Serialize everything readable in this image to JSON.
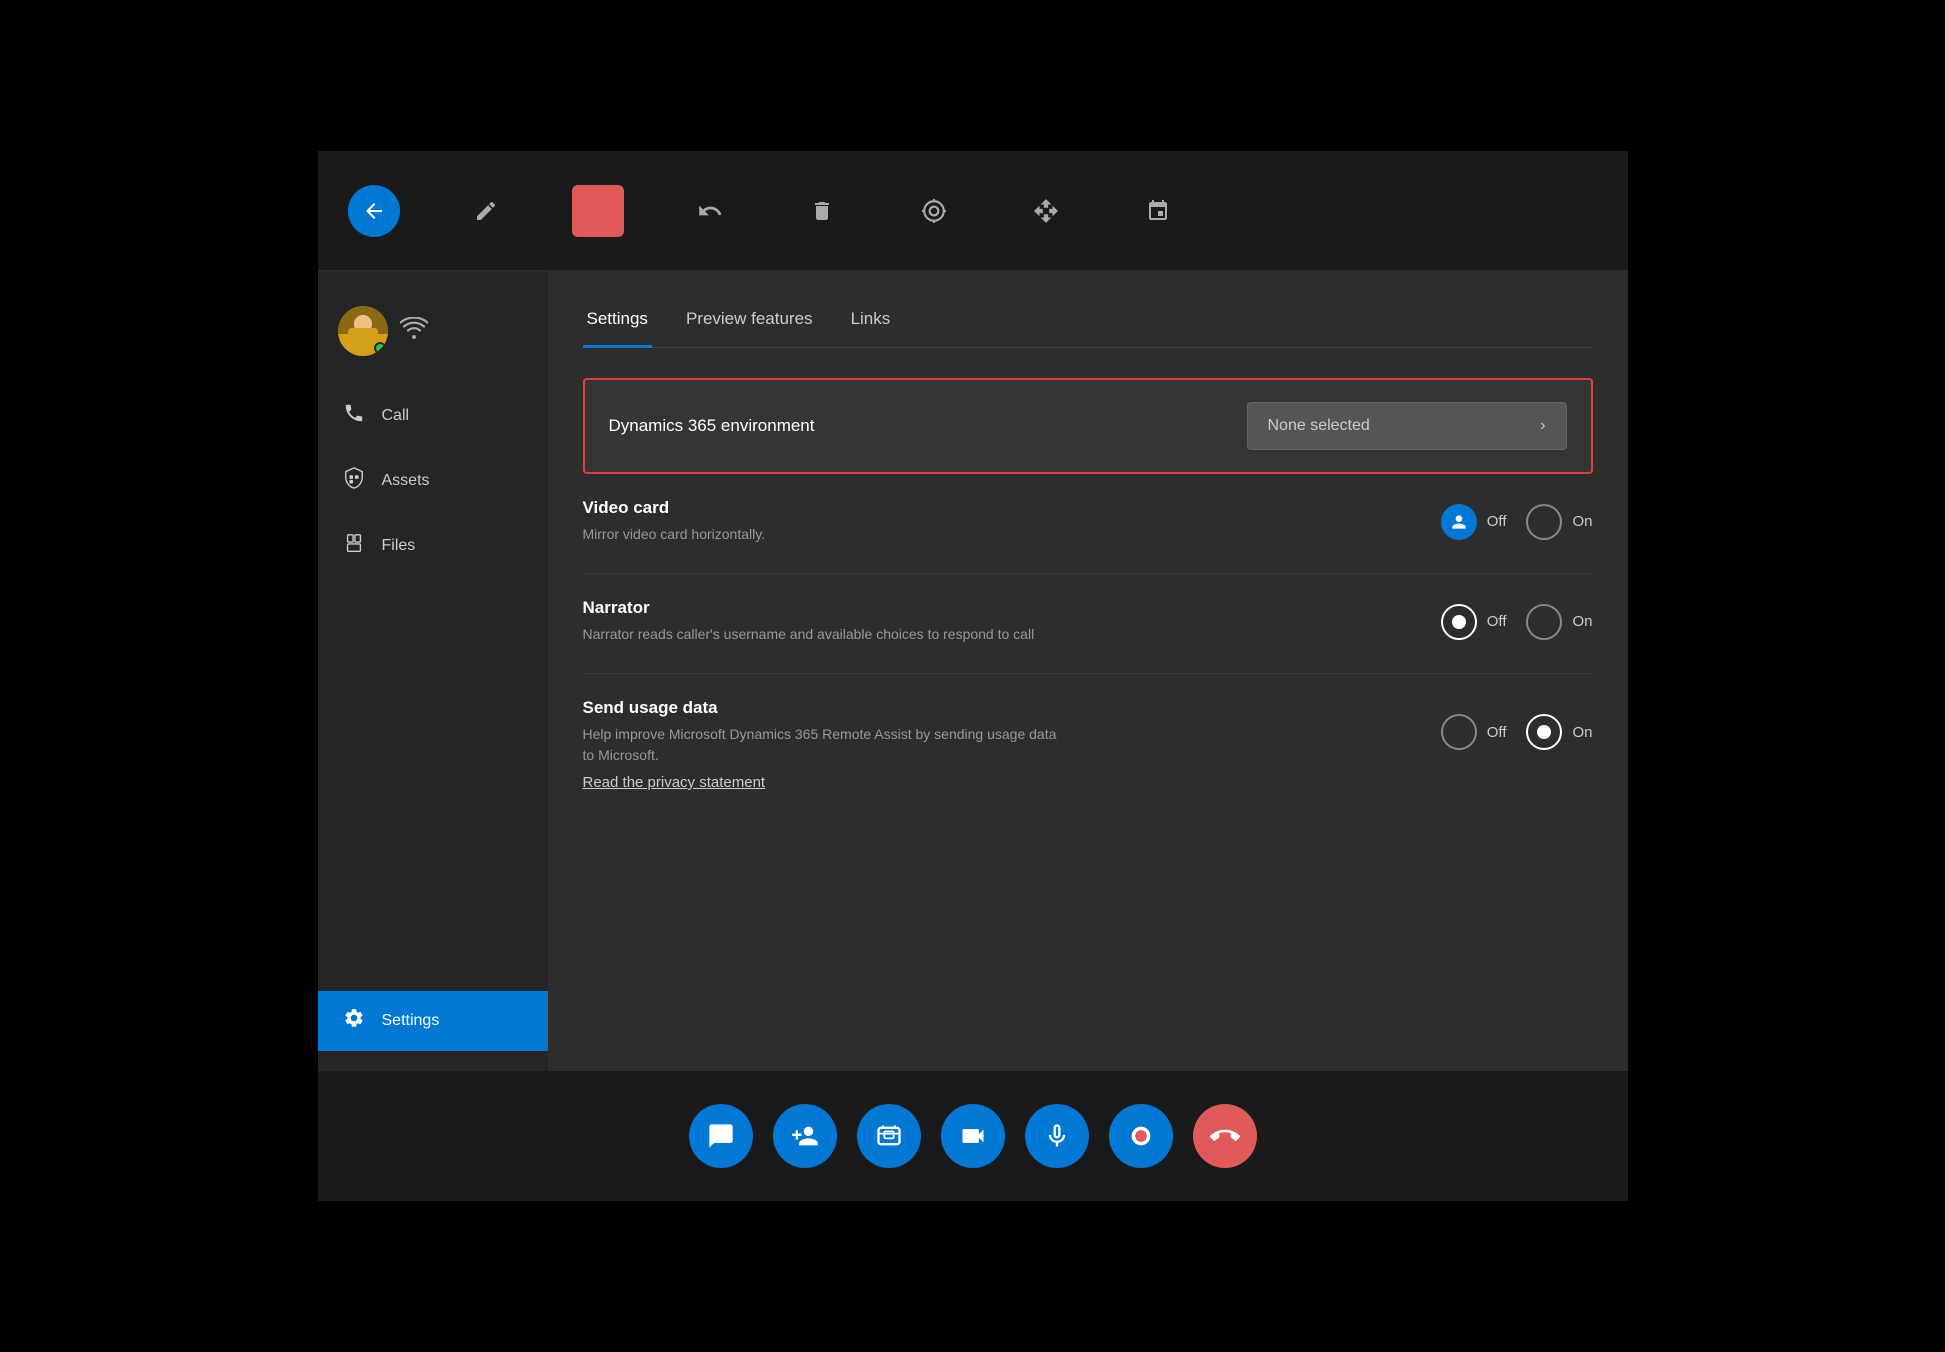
{
  "toolbar": {
    "back_icon": "↙",
    "pen_icon": "✏",
    "stop_icon": "■",
    "undo_icon": "↺",
    "delete_icon": "🗑",
    "target_icon": "◎",
    "move_icon": "✥",
    "pin_icon": "⊣"
  },
  "sidebar": {
    "wifi_icon": "📶",
    "nav_items": [
      {
        "id": "call",
        "label": "Call",
        "icon": "📞"
      },
      {
        "id": "assets",
        "label": "Assets",
        "icon": "📦"
      },
      {
        "id": "files",
        "label": "Files",
        "icon": "📄"
      }
    ],
    "active_item": "settings",
    "settings_item": {
      "id": "settings",
      "label": "Settings",
      "icon": "⚙"
    }
  },
  "tabs": [
    {
      "id": "settings",
      "label": "Settings",
      "active": true
    },
    {
      "id": "preview",
      "label": "Preview features",
      "active": false
    },
    {
      "id": "links",
      "label": "Links",
      "active": false
    }
  ],
  "settings": {
    "dynamics_section": {
      "label": "Dynamics 365 environment",
      "selector_text": "None selected",
      "selector_chevron": "›"
    },
    "video_card": {
      "title": "Video card",
      "description": "Mirror video card horizontally.",
      "off_label": "Off",
      "on_label": "On",
      "selected": "off"
    },
    "narrator": {
      "title": "Narrator",
      "description": "Narrator reads caller's username and available choices to respond to call",
      "off_label": "Off",
      "on_label": "On",
      "selected": "off"
    },
    "send_usage": {
      "title": "Send usage data",
      "description": "Help improve Microsoft Dynamics 365 Remote Assist by sending usage data to Microsoft.",
      "off_label": "Off",
      "on_label": "On",
      "selected": "on",
      "privacy_link": "Read the privacy statement"
    }
  },
  "bottom_bar": {
    "buttons": [
      {
        "id": "chat",
        "icon": "💬",
        "label": "Chat"
      },
      {
        "id": "add-person",
        "icon": "👥",
        "label": "Add person"
      },
      {
        "id": "screenshot",
        "icon": "⊡",
        "label": "Screenshot"
      },
      {
        "id": "video",
        "icon": "📹",
        "label": "Video"
      },
      {
        "id": "mic",
        "icon": "🎙",
        "label": "Microphone"
      },
      {
        "id": "record",
        "icon": "⏺",
        "label": "Record"
      },
      {
        "id": "end-call",
        "icon": "📵",
        "label": "End call"
      }
    ]
  }
}
